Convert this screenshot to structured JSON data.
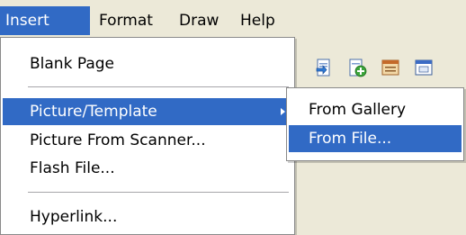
{
  "menubar": {
    "items": [
      {
        "label": "Insert"
      },
      {
        "label": "Format"
      },
      {
        "label": "Draw"
      },
      {
        "label": "Help"
      }
    ]
  },
  "insert_menu": {
    "items": [
      {
        "label": "Blank Page"
      },
      {
        "label": "Picture/Template"
      },
      {
        "label": "Picture From Scanner..."
      },
      {
        "label": "Flash File..."
      },
      {
        "label": "Hyperlink..."
      }
    ]
  },
  "submenu": {
    "items": [
      {
        "label": "From Gallery"
      },
      {
        "label": "From File..."
      }
    ]
  },
  "colors": {
    "highlight": "#316ac5",
    "face": "#ece9d8"
  },
  "toolbar": {
    "icons": [
      "import-page-icon",
      "add-page-icon",
      "form-icon",
      "window-icon"
    ]
  }
}
